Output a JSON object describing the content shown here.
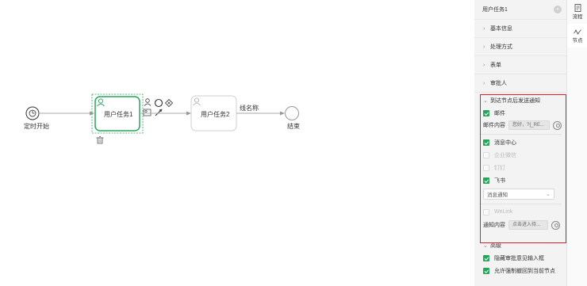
{
  "diagram": {
    "start_label": "定时开始",
    "task1_label": "用户任务1",
    "task2_label": "用户任务2",
    "edge_label": "线名称",
    "end_label": "结束"
  },
  "panel": {
    "title": "用户任务1",
    "collapse_glyph": "«",
    "sections": [
      "基本信息",
      "处理方式",
      "表单",
      "审批人"
    ],
    "notify": {
      "title": "到达节点后发送通知",
      "email_label": "邮件",
      "email_content_label": "邮件内容",
      "email_content_value": "您好，?{_RE...",
      "channels": [
        {
          "label": "消息中心",
          "checked": true,
          "disabled": false
        },
        {
          "label": "企业微信",
          "checked": false,
          "disabled": true
        },
        {
          "label": "钉钉",
          "checked": false,
          "disabled": true
        },
        {
          "label": "飞书",
          "checked": true,
          "disabled": false
        }
      ],
      "feishu_select": "消息通知",
      "welink_label": "WeLink",
      "notify_content_label": "通知内容",
      "notify_content_value": "点击进入待..."
    },
    "advanced": {
      "title": "高级",
      "options": [
        "隐藏审批意见输入框",
        "允许强制撤回到当前节点"
      ]
    }
  },
  "tabs": [
    {
      "label": "流程",
      "icon": "document-icon",
      "active": false
    },
    {
      "label": "节点",
      "icon": "node-icon",
      "active": true
    }
  ],
  "colors": {
    "accent_green": "#26a65b",
    "highlight_red": "#e02020"
  }
}
